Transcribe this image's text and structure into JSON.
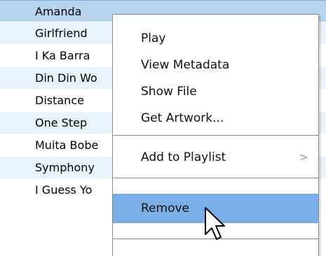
{
  "tracks": [
    {
      "title": "Amanda",
      "selected": true
    },
    {
      "title": "Girlfriend",
      "selected": false
    },
    {
      "title": "I Ka Barra",
      "selected": false
    },
    {
      "title": "Din Din Wo",
      "selected": false
    },
    {
      "title": "Distance",
      "selected": false
    },
    {
      "title": "One Step",
      "selected": false
    },
    {
      "title": "Muita Bobe",
      "selected": false
    },
    {
      "title": "Symphony",
      "selected": false
    },
    {
      "title": "I Guess Yo",
      "selected": false
    }
  ],
  "context_menu": {
    "play_label": "Play",
    "view_metadata_label": "View Metadata",
    "show_file_label": "Show File",
    "get_artwork_label": "Get Artwork...",
    "add_to_playlist_label": "Add to Playlist",
    "add_to_playlist_arrow": ">",
    "remove_label": "Remove",
    "highlight_color": "#7aaee6"
  },
  "cursor": {
    "icon": "arrow-pointer-icon"
  },
  "colors": {
    "selected_row": "#b8d3ee",
    "alt_row": "#eaf2fa"
  }
}
